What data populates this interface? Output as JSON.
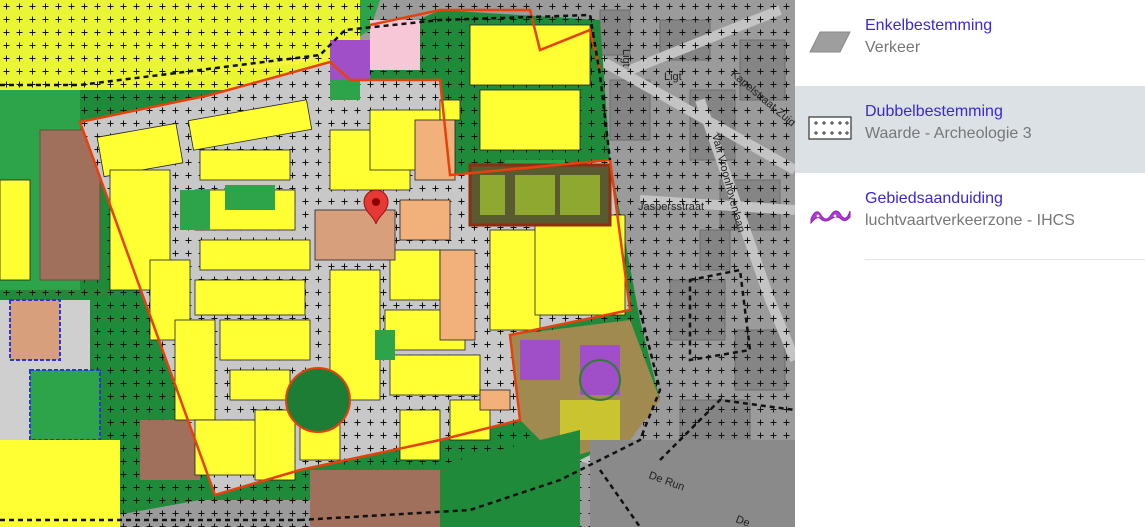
{
  "map": {
    "street_labels": [
      "Ligt",
      "Ligt",
      "Kapelstraat-Zuid",
      "Van Vroonhovenlaan",
      "Jaspersstraat",
      "De Run",
      "De"
    ],
    "location_marker": "location-pin-icon",
    "colors": {
      "residential": "#ffff33",
      "mixed": "#f2b07a",
      "commercial": "#d89f7c",
      "green": "#2aa84a",
      "forest": "#1e7d34",
      "road": "#b8b8b8",
      "boundary": "#e8400c",
      "society": "#a14fc9"
    }
  },
  "legend": {
    "items": [
      {
        "title": "Enkelbestemming",
        "subtitle": "Verkeer",
        "icon": "parallelogram-grey-icon"
      },
      {
        "title": "Dubbelbestemming",
        "subtitle": "Waarde - Archeologie 3",
        "icon": "plus-grid-icon"
      },
      {
        "title": "Gebiedsaanduiding",
        "subtitle": "luchtvaartverkeerzone - IHCS",
        "icon": "purple-wave-icon"
      }
    ],
    "selected_index": 1
  }
}
